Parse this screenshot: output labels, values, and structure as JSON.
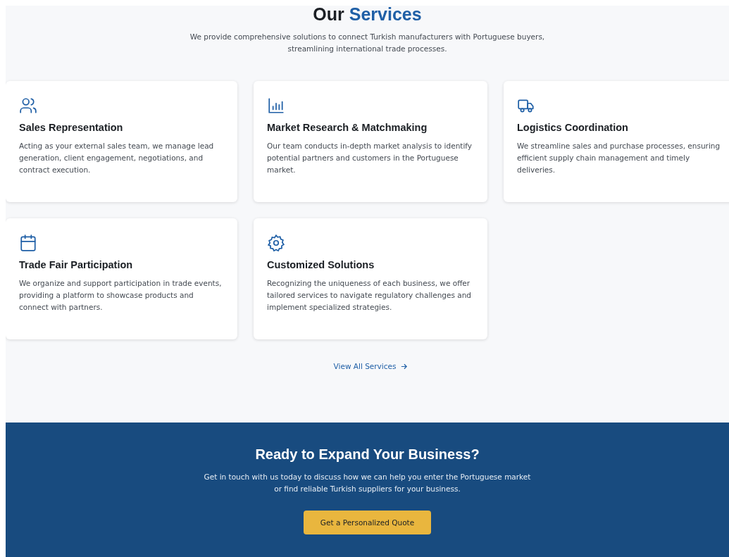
{
  "services": {
    "title": {
      "text": "Our",
      "highlight": "Services"
    },
    "intro": "We provide comprehensive solutions to connect Turkish manufacturers with Portuguese buyers, streamlining international trade processes.",
    "cards": [
      {
        "kind": "people",
        "title": "Sales Representation",
        "text": "Acting as your external sales team, we manage lead generation, client engagement, negotiations, and contract execution."
      },
      {
        "kind": "chart",
        "title": "Market Research & Matchmaking",
        "text": "Our team conducts in-depth market analysis to identify potential partners and customers in the Portuguese market."
      },
      {
        "kind": "truck",
        "title": "Logistics Coordination",
        "text": "We streamline sales and purchase processes, ensuring efficient supply chain management and timely deliveries."
      },
      {
        "kind": "calendar",
        "title": "Trade Fair Participation",
        "text": "We organize and support participation in trade events, providing a platform to showcase products and connect with partners."
      },
      {
        "kind": "gear",
        "title": "Customized Solutions",
        "text": "Recognizing the uniqueness of each business, we offer tailored services to navigate regulatory challenges and implement specialized strategies."
      }
    ],
    "link": "View All Services"
  },
  "cta": {
    "title": "Ready to Expand Your Business?",
    "text": "Get in touch with us today to discuss how we can help you enter the Portuguese market or find reliable Turkish suppliers for your business.",
    "button": "Get a Personalized Quote"
  }
}
